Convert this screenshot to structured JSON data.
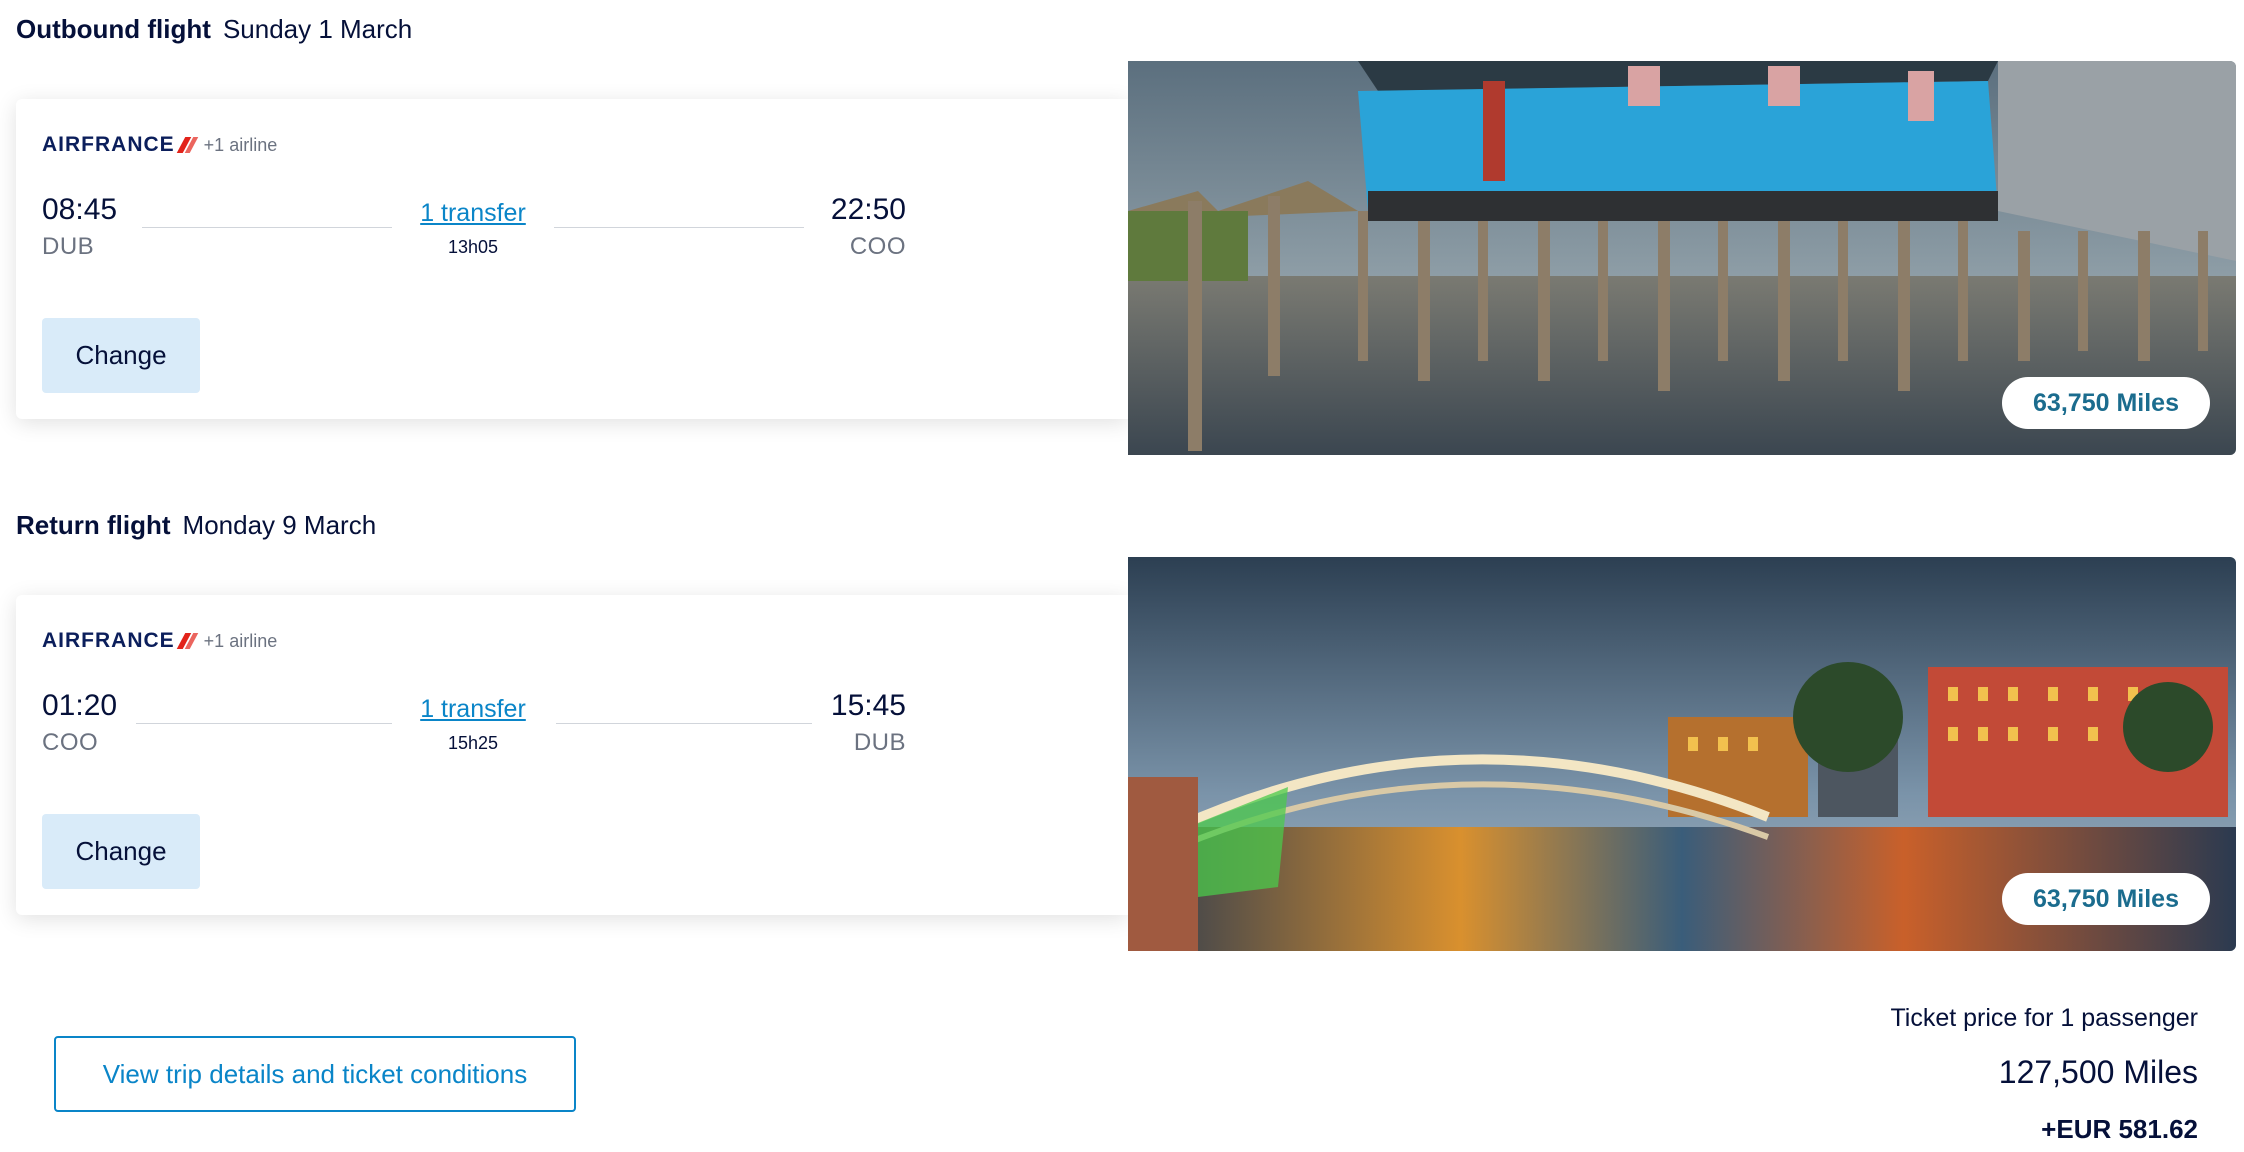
{
  "outbound": {
    "title": "Outbound flight",
    "date": "Sunday 1 March",
    "airline_logo": "AIRFRANCE",
    "extra_airline": "+1 airline",
    "depart_time": "08:45",
    "depart_code": "DUB",
    "arrive_time": "22:50",
    "arrive_code": "COO",
    "transfer": "1 transfer",
    "duration": "13h05",
    "change_label": "Change",
    "miles": "63,750 Miles",
    "image": "stilt-houses-photo"
  },
  "return": {
    "title": "Return flight",
    "date": "Monday 9 March",
    "airline_logo": "AIRFRANCE",
    "extra_airline": "+1 airline",
    "depart_time": "01:20",
    "depart_code": "COO",
    "arrive_time": "15:45",
    "arrive_code": "DUB",
    "transfer": "1 transfer",
    "duration": "15h25",
    "change_label": "Change",
    "miles": "63,750 Miles",
    "image": "dublin-bridge-night-photo"
  },
  "footer": {
    "details_button": "View trip details and ticket conditions",
    "price_label": "Ticket price for 1 passenger",
    "price_miles": "127,500 Miles",
    "price_eur": "+EUR 581.62"
  },
  "colors": {
    "link": "#0a85c8",
    "change_button_bg": "#d9ebf9",
    "text_dark": "#051039",
    "airfrance_red": "#e2231a"
  }
}
